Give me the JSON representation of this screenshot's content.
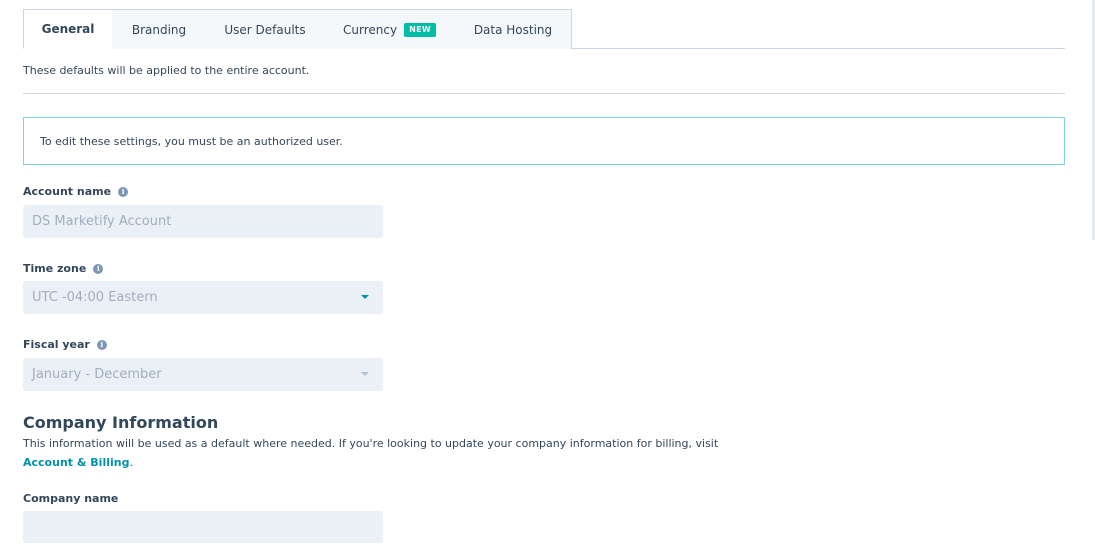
{
  "tabs": [
    {
      "label": "General",
      "active": true
    },
    {
      "label": "Branding"
    },
    {
      "label": "User Defaults"
    },
    {
      "label": "Currency",
      "badge": "NEW"
    },
    {
      "label": "Data Hosting"
    }
  ],
  "intro": "These defaults will be applied to the entire account.",
  "alert": "To edit these settings, you must be an authorized user.",
  "account_name": {
    "label": "Account name",
    "value": "DS Marketify Account"
  },
  "time_zone": {
    "label": "Time zone",
    "value": "UTC -04:00 Eastern"
  },
  "fiscal_year": {
    "label": "Fiscal year",
    "value": "January - December"
  },
  "company_info": {
    "title": "Company Information",
    "desc_prefix": "This information will be used as a default where needed. If you're looking to update your company information for billing, visit ",
    "link_label": "Account & Billing",
    "desc_suffix": "."
  },
  "company_name": {
    "label": "Company name",
    "value": ""
  },
  "colors": {
    "accent": "#0091ae",
    "badge": "#00bda5",
    "field_bg": "#eaf0f6",
    "alert_border": "#7fd1de"
  }
}
